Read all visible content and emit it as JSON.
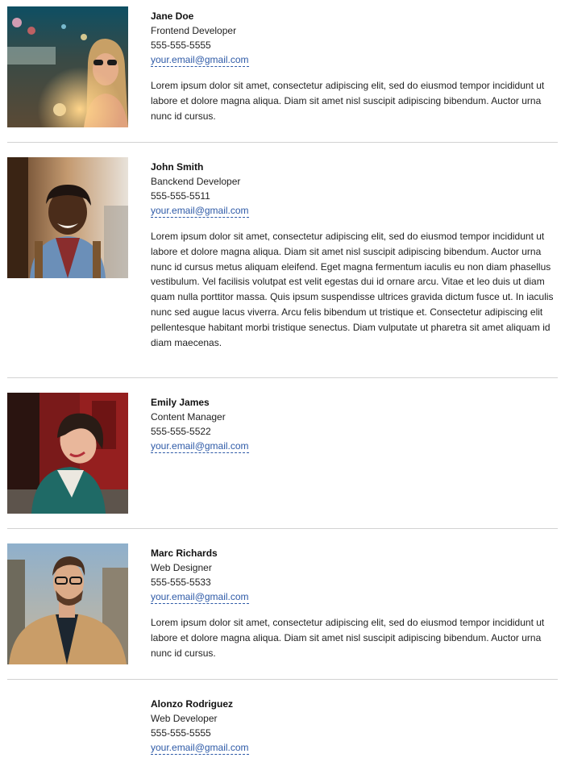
{
  "team": [
    {
      "name": "Jane Doe",
      "role": "Frontend Developer",
      "phone": "555-555-5555",
      "email": "your.email@gmail.com",
      "bio": "Lorem ipsum dolor sit amet, consectetur adipiscing elit, sed do eiusmod tempor incididunt ut labore et dolore magna aliqua. Diam sit amet nisl suscipit adipiscing bibendum. Auctor urna nunc id cursus."
    },
    {
      "name": "John Smith",
      "role": "Banckend Developer",
      "phone": "555-555-5511",
      "email": "your.email@gmail.com",
      "bio": "Lorem ipsum dolor sit amet, consectetur adipiscing elit, sed do eiusmod tempor incididunt ut labore et dolore magna aliqua. Diam sit amet nisl suscipit adipiscing bibendum. Auctor urna nunc id cursus metus aliquam eleifend. Eget magna fermentum iaculis eu non diam phasellus vestibulum. Vel facilisis volutpat est velit egestas dui id ornare arcu. Vitae et leo duis ut diam quam nulla porttitor massa. Quis ipsum suspendisse ultrices gravida dictum fusce ut. In iaculis nunc sed augue lacus viverra. Arcu felis bibendum ut tristique et. Consectetur adipiscing elit pellentesque habitant morbi tristique senectus. Diam vulputate ut pharetra sit amet aliquam id diam maecenas."
    },
    {
      "name": "Emily James",
      "role": "Content Manager",
      "phone": "555-555-5522",
      "email": "your.email@gmail.com",
      "bio": ""
    },
    {
      "name": "Marc Richards",
      "role": "Web Designer",
      "phone": "555-555-5533",
      "email": "your.email@gmail.com",
      "bio": "Lorem ipsum dolor sit amet, consectetur adipiscing elit, sed do eiusmod tempor incididunt ut labore et dolore magna aliqua. Diam sit amet nisl suscipit adipiscing bibendum. Auctor urna nunc id cursus."
    },
    {
      "name": "Alonzo Rodriguez",
      "role": "Web Developer",
      "phone": "555-555-5555",
      "email": "your.email@gmail.com",
      "bio": ""
    }
  ],
  "colors": {
    "link": "#2e5aa7",
    "divider": "#d2d2d2",
    "text": "#222222"
  }
}
